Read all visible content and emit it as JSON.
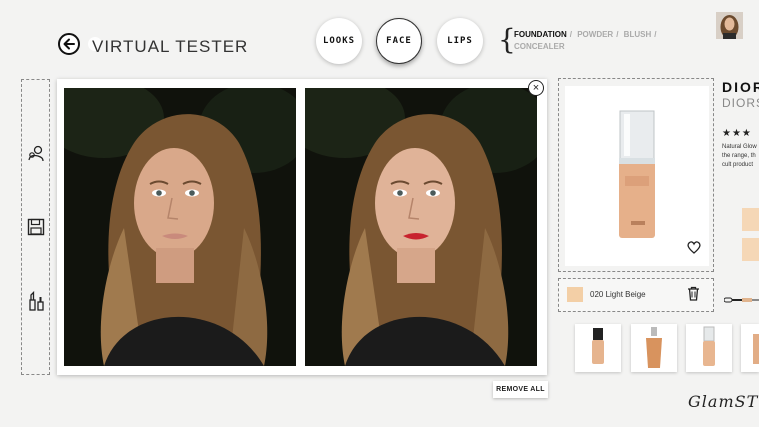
{
  "header": {
    "title": "VIRTUAL TESTER",
    "categories": [
      {
        "label": "LOOKS",
        "active": false
      },
      {
        "label": "FACE",
        "active": true
      },
      {
        "label": "LIPS",
        "active": false
      }
    ],
    "sub_nav": [
      {
        "label": "FOUNDATION",
        "active": true
      },
      {
        "label": "POWDER",
        "active": false
      },
      {
        "label": "BLUSH",
        "active": false
      },
      {
        "label": "CONCEALER",
        "active": false
      }
    ],
    "sub_nav_separator": "/"
  },
  "compare": {
    "close_glyph": "×",
    "remove_all_label": "REMOVE ALL"
  },
  "product": {
    "brand": "DIOR",
    "name": "DIORSKIN",
    "rating_stars": "★★★",
    "description_lines": [
      "Natural Glow",
      "the range, th",
      "cult product"
    ],
    "shade_label": "020 Light Beige",
    "shade_color": "#f3cfa6"
  },
  "signature": "GlamST"
}
